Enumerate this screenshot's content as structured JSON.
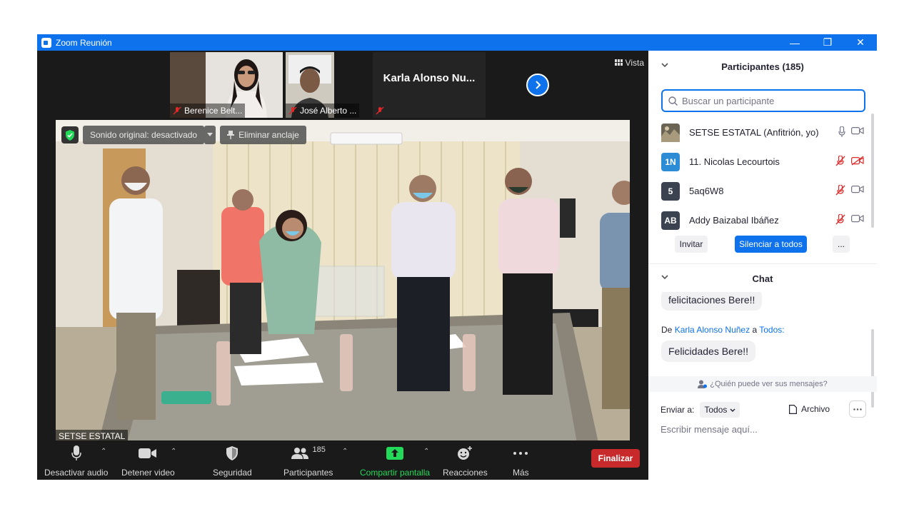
{
  "window": {
    "title": "Zoom Reunión",
    "controls": [
      "minimize",
      "restore",
      "close"
    ]
  },
  "video": {
    "vista_label": "Vista",
    "thumbnails": [
      {
        "name": "Berenice Belt..."
      },
      {
        "name": "José Alberto ..."
      },
      {
        "name": "Karla Alonso Nu..."
      }
    ],
    "main": {
      "sound_label": "Sonido original: desactivado",
      "unpin_label": "Eliminar anclaje",
      "speaker_label": "SETSE ESTATAL"
    }
  },
  "toolbar": {
    "audio_label": "Desactivar audio",
    "video_label": "Detener video",
    "security_label": "Seguridad",
    "participants_label": "Participantes",
    "participants_count": "185",
    "share_label": "Compartir pantalla",
    "reactions_label": "Reacciones",
    "more_label": "Más",
    "end_label": "Finalizar",
    "colors": {
      "share": "#23d959",
      "end": "#c8292b"
    }
  },
  "participants": {
    "title": "Participantes (185)",
    "search_placeholder": "Buscar un participante",
    "list": [
      {
        "initials": "",
        "name": "SETSE ESTATAL (Anfitrión, yo)",
        "avatar_color": "#6b6455",
        "mic": "on",
        "cam": "on"
      },
      {
        "initials": "1N",
        "name": "11. Nicolas Lecourtois",
        "avatar_color": "#2d8cd6",
        "mic": "off",
        "cam": "off"
      },
      {
        "initials": "5",
        "name": "5aq6W8",
        "avatar_color": "#3b4250",
        "mic": "off",
        "cam": "on"
      },
      {
        "initials": "AB",
        "name": "Addy Baizabal Ibáñez",
        "avatar_color": "#3b4250",
        "mic": "off",
        "cam": "on"
      }
    ],
    "invite_label": "Invitar",
    "mute_all_label": "Silenciar a todos",
    "more_label": "..."
  },
  "chat": {
    "title": "Chat",
    "messages": [
      {
        "text": "felicitaciones Bere!!"
      },
      {
        "from_prefix": "De",
        "from": "Karla Alonso Nuñez",
        "to_prefix": "a",
        "to": "Todos:",
        "text": "Felicidades Bere!!"
      }
    ],
    "who_sees": "¿Quién puede ver sus mensajes?",
    "send_to_label": "Enviar a:",
    "send_to_value": "Todos",
    "file_label": "Archivo",
    "input_placeholder": "Escribir mensaje aquí..."
  }
}
